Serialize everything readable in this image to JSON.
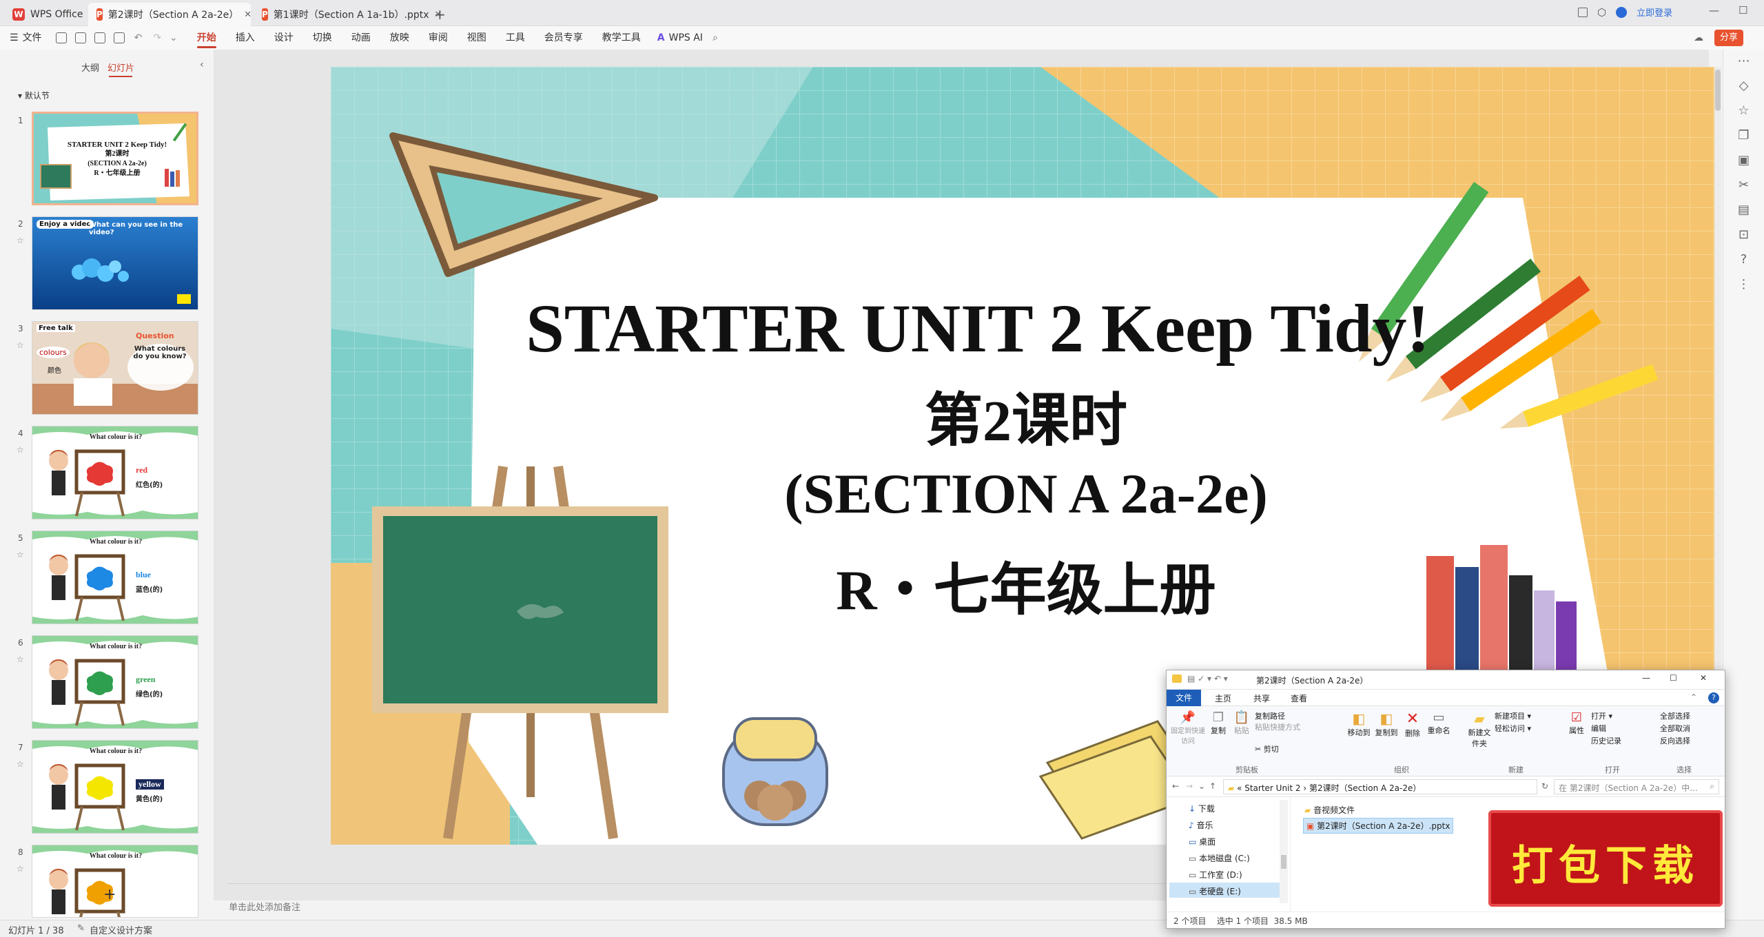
{
  "tabs": [
    {
      "label": "WPS Office"
    },
    {
      "label": "第2课时（Section A 2a-2e）"
    },
    {
      "label": "第1课时（Section A 1a-1b）.pptx"
    }
  ],
  "titlebar": {
    "login": "立即登录"
  },
  "menu": {
    "file": "文件",
    "items": [
      "开始",
      "插入",
      "设计",
      "切换",
      "动画",
      "放映",
      "审阅",
      "视图",
      "工具",
      "会员专享",
      "教学工具"
    ],
    "ai": "WPS AI",
    "share": "分享"
  },
  "panel": {
    "outline_tab": "大纲",
    "slides_tab": "幻灯片",
    "section": "默认节",
    "add": "+"
  },
  "slides": [
    {
      "num": "1",
      "lines": [
        "STARTER UNIT 2 Keep Tidy!",
        "第2课时",
        "(SECTION A 2a-2e)",
        "R・七年级上册"
      ]
    },
    {
      "num": "2",
      "label": "Enjoy a video",
      "question": "What can you see in the video?"
    },
    {
      "num": "3",
      "label": "Free talk",
      "word": "colours",
      "cn": "颜色",
      "q_title": "Question",
      "q_text": "What colours do you know?"
    },
    {
      "num": "4",
      "title": "What colour is it?",
      "word": "red",
      "cn": "红色(的)",
      "color": "#e53935"
    },
    {
      "num": "5",
      "title": "What colour is it?",
      "word": "blue",
      "cn": "蓝色(的)",
      "color": "#1e88e5"
    },
    {
      "num": "6",
      "title": "What colour is it?",
      "word": "green",
      "cn": "绿色(的)",
      "color": "#2e9e4f"
    },
    {
      "num": "7",
      "title": "What colour is it?",
      "word": "yellow",
      "cn": "黄色(的)",
      "color": "#f5e600"
    },
    {
      "num": "8",
      "title": "What colour is it?"
    }
  ],
  "main_slide": {
    "title": "STARTER UNIT 2 Keep Tidy!",
    "lesson": "第2课时",
    "section": "(SECTION A 2a-2e)",
    "grade": "R・七年级上册"
  },
  "notes_placeholder": "单击此处添加备注",
  "status": {
    "slide": "幻灯片 1 / 38",
    "design": "自定义设计方案"
  },
  "explorer": {
    "title": "第2课时（Section A 2a-2e）",
    "ribbon_tabs": [
      "文件",
      "主页",
      "共享",
      "查看"
    ],
    "buttons": {
      "pin": "固定到快速访问",
      "copy": "复制",
      "paste": "粘贴",
      "copy_path": "复制路径",
      "paste_shortcut": "粘贴快捷方式",
      "cut": "剪切",
      "move_to": "移动到",
      "copy_to": "复制到",
      "delete": "删除",
      "rename": "重命名",
      "new_folder": "新建文件夹",
      "new_item": "新建项目",
      "easy_access": "轻松访问",
      "properties": "属性",
      "open": "打开",
      "edit": "编辑",
      "history": "历史记录",
      "select_all": "全部选择",
      "select_none": "全部取消",
      "invert": "反向选择"
    },
    "groups": [
      "剪贴板",
      "组织",
      "新建",
      "打开",
      "选择"
    ],
    "path": [
      "Starter Unit 2",
      "第2课时（Section A 2a-2e）"
    ],
    "search_placeholder": "在 第2课时（Section A 2a-2e）中...",
    "nav": [
      "下载",
      "音乐",
      "桌面",
      "本地磁盘 (C:)",
      "工作室 (D:)",
      "老硬盘 (E:)"
    ],
    "files": [
      "音视频文件",
      "第2课时（Section A 2a-2e）.pptx"
    ],
    "status": "2 个项目    选中 1 个项目  38.5 MB"
  },
  "banner": {
    "text": "打包下载"
  }
}
